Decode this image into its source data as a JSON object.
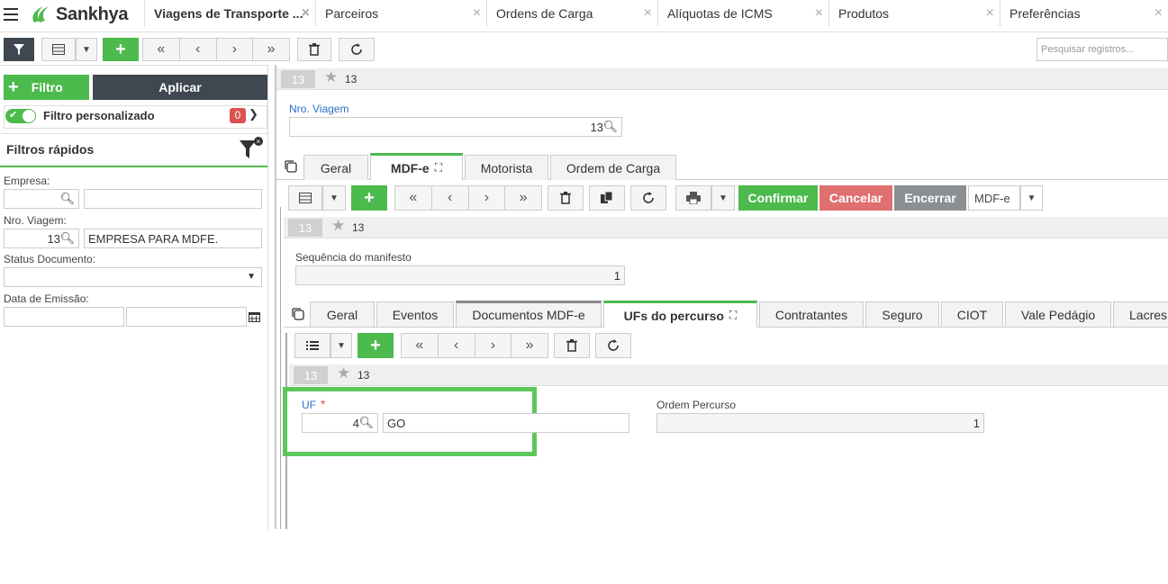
{
  "app": {
    "brand": "Sankhya"
  },
  "top_tabs": [
    {
      "label": "Viagens de Transporte ..."
    },
    {
      "label": "Parceiros"
    },
    {
      "label": "Ordens de Carga"
    },
    {
      "label": "Alíquotas de ICMS"
    },
    {
      "label": "Produtos"
    },
    {
      "label": "Preferências"
    }
  ],
  "toolbar": {
    "search_placeholder": "Pesquisar registros..."
  },
  "filter": {
    "filter_label": "Filtro",
    "apply_label": "Aplicar",
    "custom_label": "Filtro personalizado",
    "custom_count": "0",
    "quick_title": "Filtros rápidos",
    "empresa_label": "Empresa:",
    "nro_label": "Nro. Viagem:",
    "nro_value": "13",
    "nro_desc": "EMPRESA PARA MDFE.",
    "status_label": "Status Documento:",
    "data_label": "Data de Emissão:"
  },
  "record": {
    "pill": "13",
    "star_num": "13",
    "nro_viagem_label": "Nro. Viagem",
    "nro_viagem_value": "13"
  },
  "tabs1": [
    "Geral",
    "MDF-e",
    "Motorista",
    "Ordem de Carga"
  ],
  "toolbar2": {
    "confirm": "Confirmar",
    "cancel": "Cancelar",
    "close": "Encerrar",
    "mdfe": "MDF-e"
  },
  "record2": {
    "pill": "13",
    "star_num": "13",
    "seq_label": "Sequência do manifesto",
    "seq_value": "1"
  },
  "tabs2": [
    "Geral",
    "Eventos",
    "Documentos MDF-e",
    "UFs do percurso",
    "Contratantes",
    "Seguro",
    "CIOT",
    "Vale Pedágio",
    "Lacres"
  ],
  "record3": {
    "pill": "13",
    "star_num": "13",
    "uf_label": "UF",
    "uf_required": "*",
    "uf_code": "4",
    "uf_name": "GO",
    "ordem_label": "Ordem Percurso",
    "ordem_value": "1"
  },
  "colors": {
    "accent": "#4cba4c",
    "dark": "#3f4850",
    "cancel": "#e07070",
    "close": "#8a8f94",
    "highlight": "#5cc85c"
  }
}
